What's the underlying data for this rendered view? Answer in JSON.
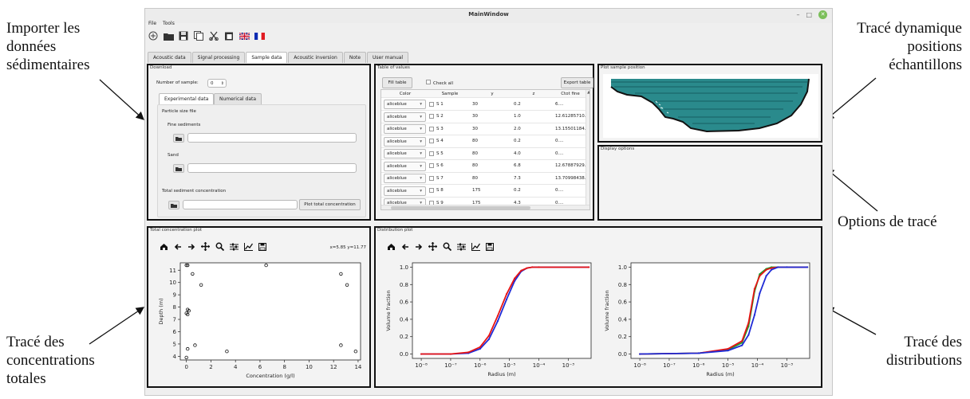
{
  "annotations": {
    "import_lines": [
      "Importer les",
      "données",
      "sédimentaires"
    ],
    "dynamic_lines": [
      "Tracé dynamique",
      "positions",
      "échantillons"
    ],
    "options_lines": [
      "Options de tracé"
    ],
    "concentrations_lines": [
      "Tracé des",
      "concentrations",
      "totales"
    ],
    "distributions_lines": [
      "Tracé des",
      "distributions"
    ]
  },
  "window": {
    "title": "MainWindow",
    "menu": [
      "File",
      "Tools"
    ],
    "toolbar_icons": [
      "add-icon",
      "folder-icon",
      "save-icon",
      "copy-icon",
      "cut-icon",
      "paste-icon",
      "flag-uk-icon",
      "flag-fr-icon"
    ],
    "tabs": [
      "Acoustic data",
      "Signal processing",
      "Sample data",
      "Acoustic inversion",
      "Note",
      "User manual"
    ],
    "active_tab": "Sample data"
  },
  "download": {
    "title": "Download",
    "number_of_sample_label": "Number of sample:",
    "number_of_sample_value": "0",
    "subtabs": [
      "Experimental data",
      "Numerical data"
    ],
    "particle_size_file": "Particle size file",
    "fine_sediments": "Fine sediments",
    "sand": "Sand",
    "total_sediment_concentration": "Total sediment concentration",
    "plot_total_concentration": "Plot total concentration"
  },
  "table_panel": {
    "title": "Table of values",
    "fill_table": "Fill table",
    "check_all": "Check all",
    "export_table": "Export table",
    "headers": [
      "Color",
      "Sample",
      "y",
      "z",
      "Ctot fine"
    ],
    "rows": [
      {
        "color": "aliceblue",
        "sample": "S 1",
        "y": "30",
        "z": "0.2",
        "ctot": "6...."
      },
      {
        "color": "aliceblue",
        "sample": "S 2",
        "y": "30",
        "z": "1.0",
        "ctot": "12.61285710..."
      },
      {
        "color": "aliceblue",
        "sample": "S 3",
        "y": "30",
        "z": "2.0",
        "ctot": "13.15501184..."
      },
      {
        "color": "aliceblue",
        "sample": "S 4",
        "y": "80",
        "z": "0.2",
        "ctot": "0...."
      },
      {
        "color": "aliceblue",
        "sample": "S 5",
        "y": "80",
        "z": "4.0",
        "ctot": "0...."
      },
      {
        "color": "aliceblue",
        "sample": "S 6",
        "y": "80",
        "z": "6.8",
        "ctot": "12.67887929..."
      },
      {
        "color": "aliceblue",
        "sample": "S 7",
        "y": "80",
        "z": "7.3",
        "ctot": "13.70998438..."
      },
      {
        "color": "aliceblue",
        "sample": "S 8",
        "y": "175",
        "z": "0.2",
        "ctot": "0...."
      },
      {
        "color": "aliceblue",
        "sample": "S 9",
        "y": "175",
        "z": "4.3",
        "ctot": "0...."
      }
    ]
  },
  "plot_position": {
    "title": "Plot sample position"
  },
  "display_options": {
    "title": "Display options"
  },
  "concentration_plot": {
    "title": "Total concentration plot",
    "coords": "x=5.85 y=11.77"
  },
  "distribution_plot": {
    "title": "Distribution plot"
  },
  "colors": {
    "blue": "#1f2bd6",
    "green": "#1a9a2a",
    "red": "#e81414",
    "seabed": "#2a8a8c"
  },
  "chart_data": [
    {
      "type": "scatter",
      "xlabel": "Concentration (g/l)",
      "ylabel": "Depth (m)",
      "xlim": [
        -0.5,
        14.2
      ],
      "ylim": [
        3.7,
        11.6
      ],
      "x_ticks": [
        "0",
        "2",
        "4",
        "6",
        "8",
        "10",
        "12",
        "14"
      ],
      "y_ticks": [
        "4",
        "5",
        "6",
        "7",
        "8",
        "9",
        "10",
        "11"
      ],
      "points": [
        {
          "x": 0.0,
          "y": 11.4
        },
        {
          "x": 0.1,
          "y": 11.4
        },
        {
          "x": 0.5,
          "y": 10.7
        },
        {
          "x": 1.2,
          "y": 9.8
        },
        {
          "x": 6.5,
          "y": 11.4
        },
        {
          "x": 12.6,
          "y": 10.7
        },
        {
          "x": 13.1,
          "y": 9.8
        },
        {
          "x": 0.1,
          "y": 7.8
        },
        {
          "x": 0.2,
          "y": 7.7
        },
        {
          "x": 0.0,
          "y": 7.5
        },
        {
          "x": 0.1,
          "y": 7.4
        },
        {
          "x": 0.7,
          "y": 4.9
        },
        {
          "x": 12.6,
          "y": 4.9
        },
        {
          "x": 0.1,
          "y": 4.6
        },
        {
          "x": 3.3,
          "y": 4.4
        },
        {
          "x": 13.8,
          "y": 4.4
        },
        {
          "x": 0.0,
          "y": 3.9
        }
      ]
    },
    {
      "type": "line",
      "xlabel": "Radius (m)",
      "ylabel": "Volume fraction",
      "x_scale": "log",
      "xlim": [
        5e-09,
        0.006
      ],
      "ylim": [
        -0.05,
        1.05
      ],
      "x_ticks": [
        "10⁻⁸",
        "10⁻⁷",
        "10⁻⁶",
        "10⁻⁵",
        "10⁻⁴",
        "10⁻³"
      ],
      "y_ticks": [
        "0.0",
        "0.2",
        "0.4",
        "0.6",
        "0.8",
        "1.0"
      ],
      "series": [
        {
          "color": "blue",
          "x": [
            1e-08,
            1e-07,
            4e-07,
            1e-06,
            2e-06,
            4e-06,
            8e-06,
            1.5e-05,
            2.5e-05,
            4e-05,
            6e-05,
            0.0001,
            0.005
          ],
          "y": [
            0,
            0,
            0.01,
            0.06,
            0.17,
            0.38,
            0.63,
            0.84,
            0.95,
            0.99,
            1.0,
            1.0,
            1.0
          ]
        },
        {
          "color": "red",
          "x": [
            1e-08,
            1e-07,
            4e-07,
            1e-06,
            2e-06,
            4e-06,
            8e-06,
            1.5e-05,
            2.5e-05,
            4e-05,
            6e-05,
            0.0001,
            0.005
          ],
          "y": [
            0,
            0,
            0.02,
            0.08,
            0.21,
            0.44,
            0.69,
            0.87,
            0.96,
            0.99,
            1.0,
            1.0,
            1.0
          ]
        }
      ]
    },
    {
      "type": "line",
      "xlabel": "Radius (m)",
      "ylabel": "Volume fraction",
      "x_scale": "log",
      "xlim": [
        5e-09,
        0.006
      ],
      "ylim": [
        -0.05,
        1.05
      ],
      "x_ticks": [
        "10⁻⁸",
        "10⁻⁷",
        "10⁻⁶",
        "10⁻⁵",
        "10⁻⁴",
        "10⁻³"
      ],
      "y_ticks": [
        "0.0",
        "0.2",
        "0.4",
        "0.6",
        "0.8",
        "1.0"
      ],
      "series": [
        {
          "color": "green",
          "x": [
            1e-08,
            1e-06,
            1e-05,
            3e-05,
            5e-05,
            8e-05,
            0.00012,
            0.0002,
            0.0003,
            0.0005,
            0.001,
            0.005
          ],
          "y": [
            0,
            0.01,
            0.05,
            0.13,
            0.32,
            0.72,
            0.92,
            0.98,
            1.0,
            1.0,
            1.0,
            1.0
          ]
        },
        {
          "color": "red",
          "x": [
            1e-08,
            1e-06,
            1e-05,
            3e-05,
            5e-05,
            8e-05,
            0.00012,
            0.0002,
            0.0003,
            0.0005,
            0.001,
            0.005
          ],
          "y": [
            0,
            0.01,
            0.06,
            0.15,
            0.36,
            0.75,
            0.9,
            0.97,
            0.99,
            1.0,
            1.0,
            1.0
          ]
        },
        {
          "color": "blue",
          "x": [
            1e-08,
            1e-06,
            1e-05,
            3e-05,
            5e-05,
            8e-05,
            0.00012,
            0.0002,
            0.0003,
            0.0005,
            0.001,
            0.005
          ],
          "y": [
            0,
            0.01,
            0.04,
            0.1,
            0.22,
            0.45,
            0.7,
            0.9,
            0.97,
            1.0,
            1.0,
            1.0
          ]
        }
      ]
    }
  ]
}
